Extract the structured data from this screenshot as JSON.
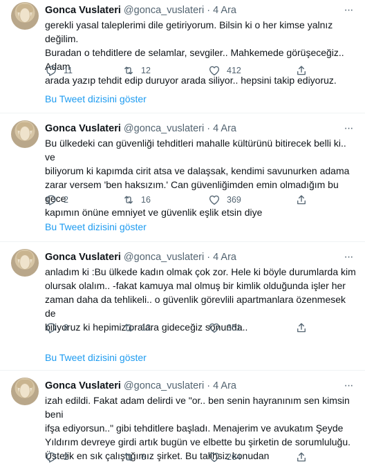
{
  "tweets": [
    {
      "name": "Gonca Vuslateri",
      "handle": "@gonca_vuslateri",
      "separator": "·",
      "time": "4 Ara",
      "more": "···",
      "lines": [
        "gerekli yasal taleplerimi dile getiriyorum. Bilsin ki o her kimse yalnız değilim.",
        "Buradan o tehditlere de selamlar, sevgiler.. Mahkemede görüşeceğiz.. Adam",
        "arada yazıp tehdit edip duruyor arada siliyor.. hepsini takip ediyoruz."
      ],
      "replies": "11",
      "retweets": "12",
      "likes": "412",
      "thread_link": "Bu Tweet dizisini göster"
    },
    {
      "name": "Gonca Vuslateri",
      "handle": "@gonca_vuslateri",
      "separator": "·",
      "time": "4 Ara",
      "more": "···",
      "lines": [
        "Bu ülkedeki can güvenliği tehditleri mahalle kültürünü bitirecek belli ki..  ve",
        "biliyorum ki kapımda cirit atsa ve dalaşsak, kendimi savunurken adama",
        "zarar versem 'ben haksızım.'  Can güvenliğimden emin olmadığım bu gece",
        "kapımın önüne emniyet ve güvenlik eşlik etsin diye"
      ],
      "replies": "2",
      "retweets": "16",
      "likes": "369",
      "thread_link": "Bu Tweet dizisini göster"
    },
    {
      "name": "Gonca Vuslateri",
      "handle": "@gonca_vuslateri",
      "separator": "·",
      "time": "4 Ara",
      "more": "···",
      "lines": [
        "anladım ki :Bu ülkede kadın olmak çok zor. Hele ki böyle durumlarda kim",
        "olursak olalım.. -fakat kamuya mal olmuş bir kimlik olduğunda işler her",
        "zaman daha da tehlikeli.. o güvenlik görevlili apartmanlara özenmesek de",
        "biliyoruz ki hepimiz oralara gideceğiz sonunda.."
      ],
      "replies": "8",
      "retweets": "13",
      "likes": "351",
      "thread_link": "Bu Tweet dizisini göster"
    },
    {
      "name": "Gonca Vuslateri",
      "handle": "@gonca_vuslateri",
      "separator": "·",
      "time": "4 Ara",
      "more": "···",
      "lines": [
        "izah edildi. Fakat adam delirdi ve \"or.. ben senin hayranınım sen kimsin beni",
        "ifşa ediyorsun..\" gibi tehditlere başladı. Menajerim ve avukatım Şeyde",
        "Yıldırım devreye girdi artık bugün ve elbette bu şirketin de sorumluluğu.",
        "Üstelik en sık çalıştığımız şirket. Bu talihsiz konudan"
      ],
      "replies": "2",
      "retweets": "6",
      "likes": "264"
    }
  ],
  "icons": {
    "reply": "reply-icon",
    "retweet": "retweet-icon",
    "like": "like-icon",
    "share": "share-icon"
  },
  "colors": {
    "text": "#0f1419",
    "secondary": "#536471",
    "link": "#1d9bf0",
    "divider": "#eff3f4"
  }
}
